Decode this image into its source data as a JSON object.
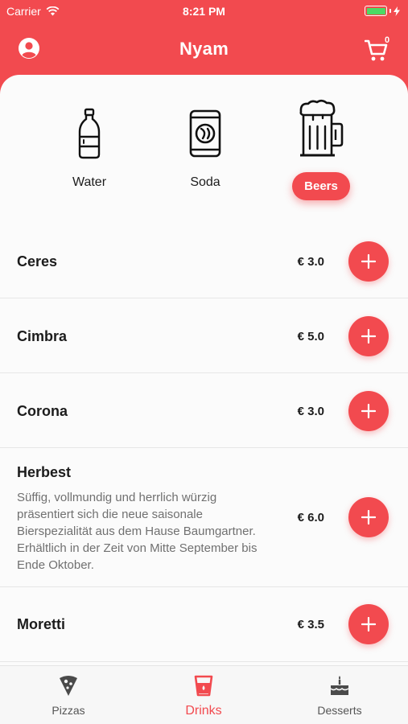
{
  "status_bar": {
    "carrier": "Carrier",
    "time": "8:21 PM"
  },
  "header": {
    "title": "Nyam",
    "cart_count": "0"
  },
  "categories": [
    {
      "label": "Water",
      "icon": "water-bottle-icon",
      "active": false
    },
    {
      "label": "Soda",
      "icon": "soda-can-icon",
      "active": false
    },
    {
      "label": "Beers",
      "icon": "beer-mug-icon",
      "active": true
    }
  ],
  "products": [
    {
      "name": "Ceres",
      "price": "€ 3.0"
    },
    {
      "name": "Cimbra",
      "price": "€ 5.0"
    },
    {
      "name": "Corona",
      "price": "€ 3.0"
    },
    {
      "name": "Herbest",
      "price": "€ 6.0",
      "description": "Süffig, vollmundig und herrlich würzig präsentiert sich die neue saisonale Bierspezialität aus dem Hause Baumgartner. Erhältlich in der Zeit von Mitte September bis Ende Oktober."
    },
    {
      "name": "Moretti",
      "price": "€ 3.5"
    }
  ],
  "tabs": [
    {
      "label": "Pizzas",
      "icon": "pizza-slice-icon"
    },
    {
      "label": "Drinks",
      "icon": "drink-cup-icon",
      "active": true
    },
    {
      "label": "Desserts",
      "icon": "cake-icon"
    }
  ],
  "colors": {
    "accent": "#f24a4f",
    "battery": "#4cd964"
  }
}
